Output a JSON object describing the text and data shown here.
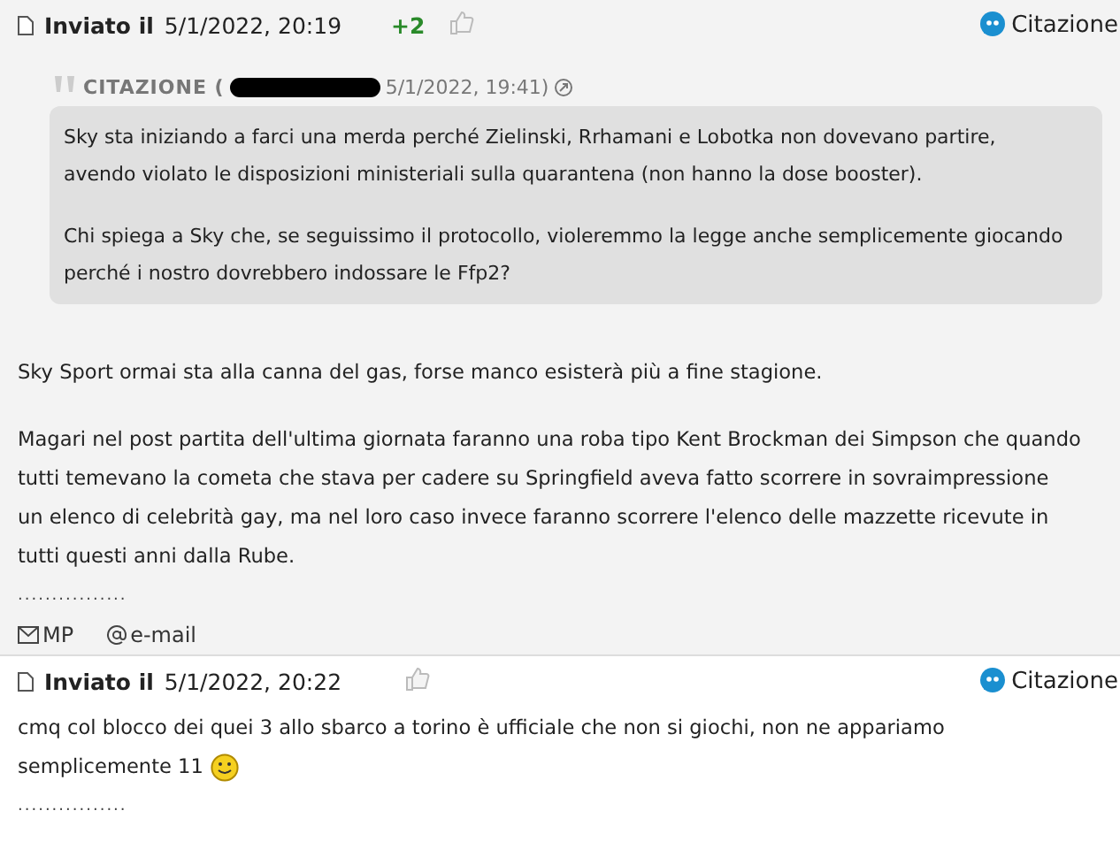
{
  "posts": [
    {
      "header": {
        "label": "Inviato il",
        "date": "5/1/2022, 20:19",
        "votes": "+2",
        "quote_button": "Citazione"
      },
      "quote": {
        "label": "CITAZIONE (",
        "meta": "5/1/2022, 19:41)",
        "paragraphs": [
          [
            "Sky sta iniziando a farci una merda perché Zielinski, Rrhamani e Lobotka non dovevano partire,",
            "avendo violato le disposizioni ministeriali sulla quarantena (non hanno la dose booster)."
          ],
          [
            "Chi spiega a Sky che, se seguissimo il protocollo, violeremmo la legge anche semplicemente giocando",
            "perché i nostro dovrebbero indossare le Ffp2?"
          ]
        ]
      },
      "paragraphs": [
        [
          "Sky Sport ormai sta alla canna del gas, forse manco esisterà più a fine stagione."
        ],
        [
          "Magari nel post partita dell'ultima giornata faranno una roba tipo Kent Brockman dei Simpson che quando",
          "tutti temevano la cometa che stava per cadere su Springfield aveva fatto scorrere in sovraimpressione",
          "un elenco di celebrità gay, ma nel loro caso invece faranno scorrere l'elenco delle mazzette ricevute in",
          "tutti questi anni dalla Rube."
        ]
      ],
      "signature": "................",
      "footer": [
        "MP",
        "e-mail"
      ]
    },
    {
      "header": {
        "label": "Inviato il",
        "date": "5/1/2022, 20:22",
        "quote_button": "Citazione"
      },
      "paragraphs": [
        [
          "cmq col blocco dei quei 3 allo sbarco a torino è ufficiale che non si giochi, non ne appariamo",
          "semplicemente 11"
        ]
      ],
      "smiley": true,
      "signature": "................"
    }
  ]
}
